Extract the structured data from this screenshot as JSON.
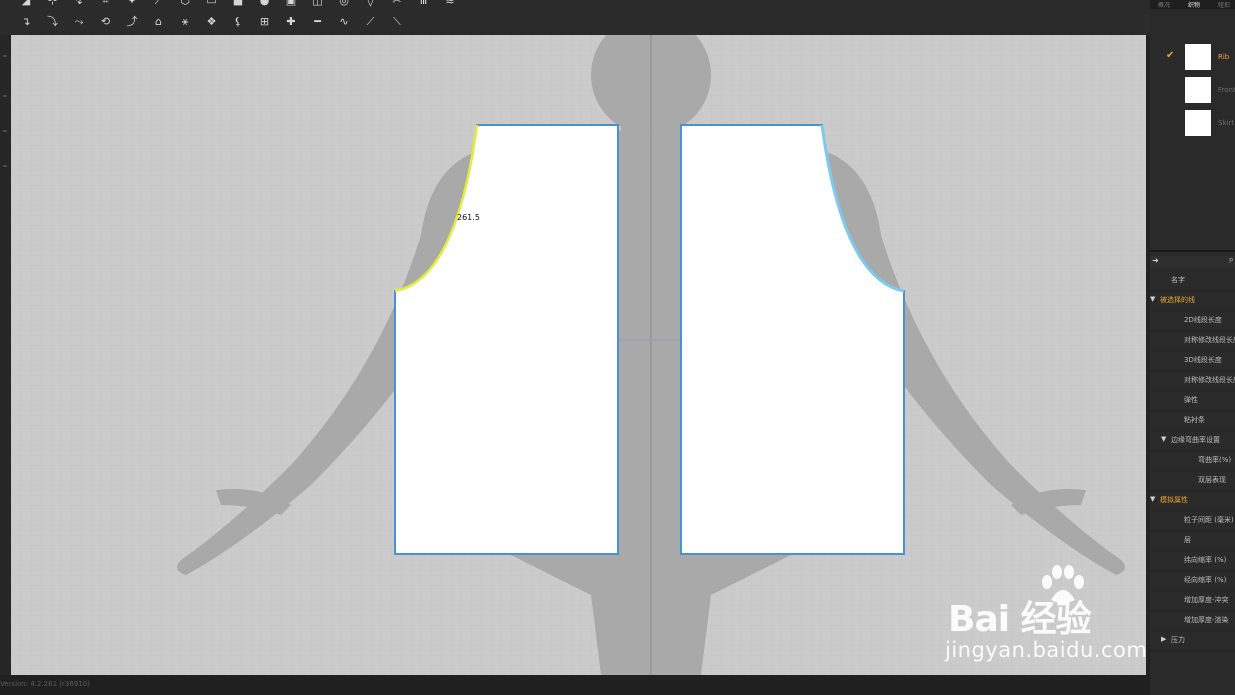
{
  "toolbar": {
    "row1_icons": [
      "segment-icon",
      "edit-point-icon",
      "curve-point-icon",
      "add-point-icon",
      "transform-icon",
      "edit-curvature-icon",
      "polygon-icon",
      "rectangle-icon",
      "square-icon",
      "circle-icon",
      "internal-polygon-icon",
      "internal-rectangle-icon",
      "internal-circle-icon",
      "dart-icon",
      "cut-icon",
      "sewing-lines-icon",
      "sewing-free-icon"
    ],
    "row2_icons": [
      "fold-arrange-icon",
      "fold-flat-icon",
      "fold-seam-icon",
      "rotate-fold-icon",
      "unfold-icon",
      "iron-icon",
      "sew-icon",
      "segment-sew-icon",
      "free-sew-icon",
      "multi-sew-icon",
      "pin-icon",
      "tape-icon",
      "elastic-icon",
      "measure-icon",
      "ruler-icon"
    ]
  },
  "viewport": {
    "measurement_label": "261.5",
    "colors": {
      "background": "#cbcbcb",
      "grid": "#c1c1c1",
      "avatar": "#a9a9a9",
      "pattern_fill": "#ffffff",
      "pattern_outline": "#4b8fd6",
      "selected_curve": "#e4ec3a",
      "highlight_outline": "#7cc9f2"
    }
  },
  "status": {
    "version": "Version: 4.2.261 (r36910)"
  },
  "right_panel": {
    "tabs": [
      "概况",
      "织物",
      "纽扣"
    ],
    "active_tab": 1,
    "fabrics": [
      {
        "name": "Rib",
        "selected": true
      },
      {
        "name": "Front",
        "selected": false
      },
      {
        "name": "Skirt",
        "selected": false
      }
    ],
    "property_header_letter": "P",
    "property_rows": [
      {
        "label": "名字",
        "indent": 1,
        "section": false,
        "arrow": ""
      },
      {
        "label": "被选择的线",
        "indent": 0,
        "section": true,
        "arrow": "▼"
      },
      {
        "label": "2D线段长度",
        "indent": 2,
        "section": false,
        "arrow": ""
      },
      {
        "label": "对称修改线段长度",
        "indent": 2,
        "section": false,
        "arrow": ""
      },
      {
        "label": "3D线段长度",
        "indent": 2,
        "section": false,
        "arrow": ""
      },
      {
        "label": "对称修改线段长度",
        "indent": 2,
        "section": false,
        "arrow": ""
      },
      {
        "label": "弹性",
        "indent": 2,
        "section": false,
        "arrow": ""
      },
      {
        "label": "粘衬条",
        "indent": 2,
        "section": false,
        "arrow": ""
      },
      {
        "label": "边缘弯曲率设置",
        "indent": 1,
        "section": false,
        "arrow": "▼"
      },
      {
        "label": "弯曲率(%)",
        "indent": 3,
        "section": false,
        "arrow": ""
      },
      {
        "label": "双层表现",
        "indent": 3,
        "section": false,
        "arrow": ""
      },
      {
        "label": "模拟属性",
        "indent": 0,
        "section": true,
        "arrow": "▼"
      },
      {
        "label": "粒子间距 (毫米)",
        "indent": 2,
        "section": false,
        "arrow": ""
      },
      {
        "label": "层",
        "indent": 2,
        "section": false,
        "arrow": ""
      },
      {
        "label": "纬向缩率 (%)",
        "indent": 2,
        "section": false,
        "arrow": ""
      },
      {
        "label": "经向缩率 (%)",
        "indent": 2,
        "section": false,
        "arrow": ""
      },
      {
        "label": "增加厚度-冲突",
        "indent": 2,
        "section": false,
        "arrow": ""
      },
      {
        "label": "增加厚度-渲染",
        "indent": 2,
        "section": false,
        "arrow": ""
      },
      {
        "label": "压力",
        "indent": 1,
        "section": false,
        "arrow": "▶"
      }
    ]
  },
  "watermark": {
    "brand": "Bai  经验",
    "url": "jingyan.baidu.com"
  }
}
